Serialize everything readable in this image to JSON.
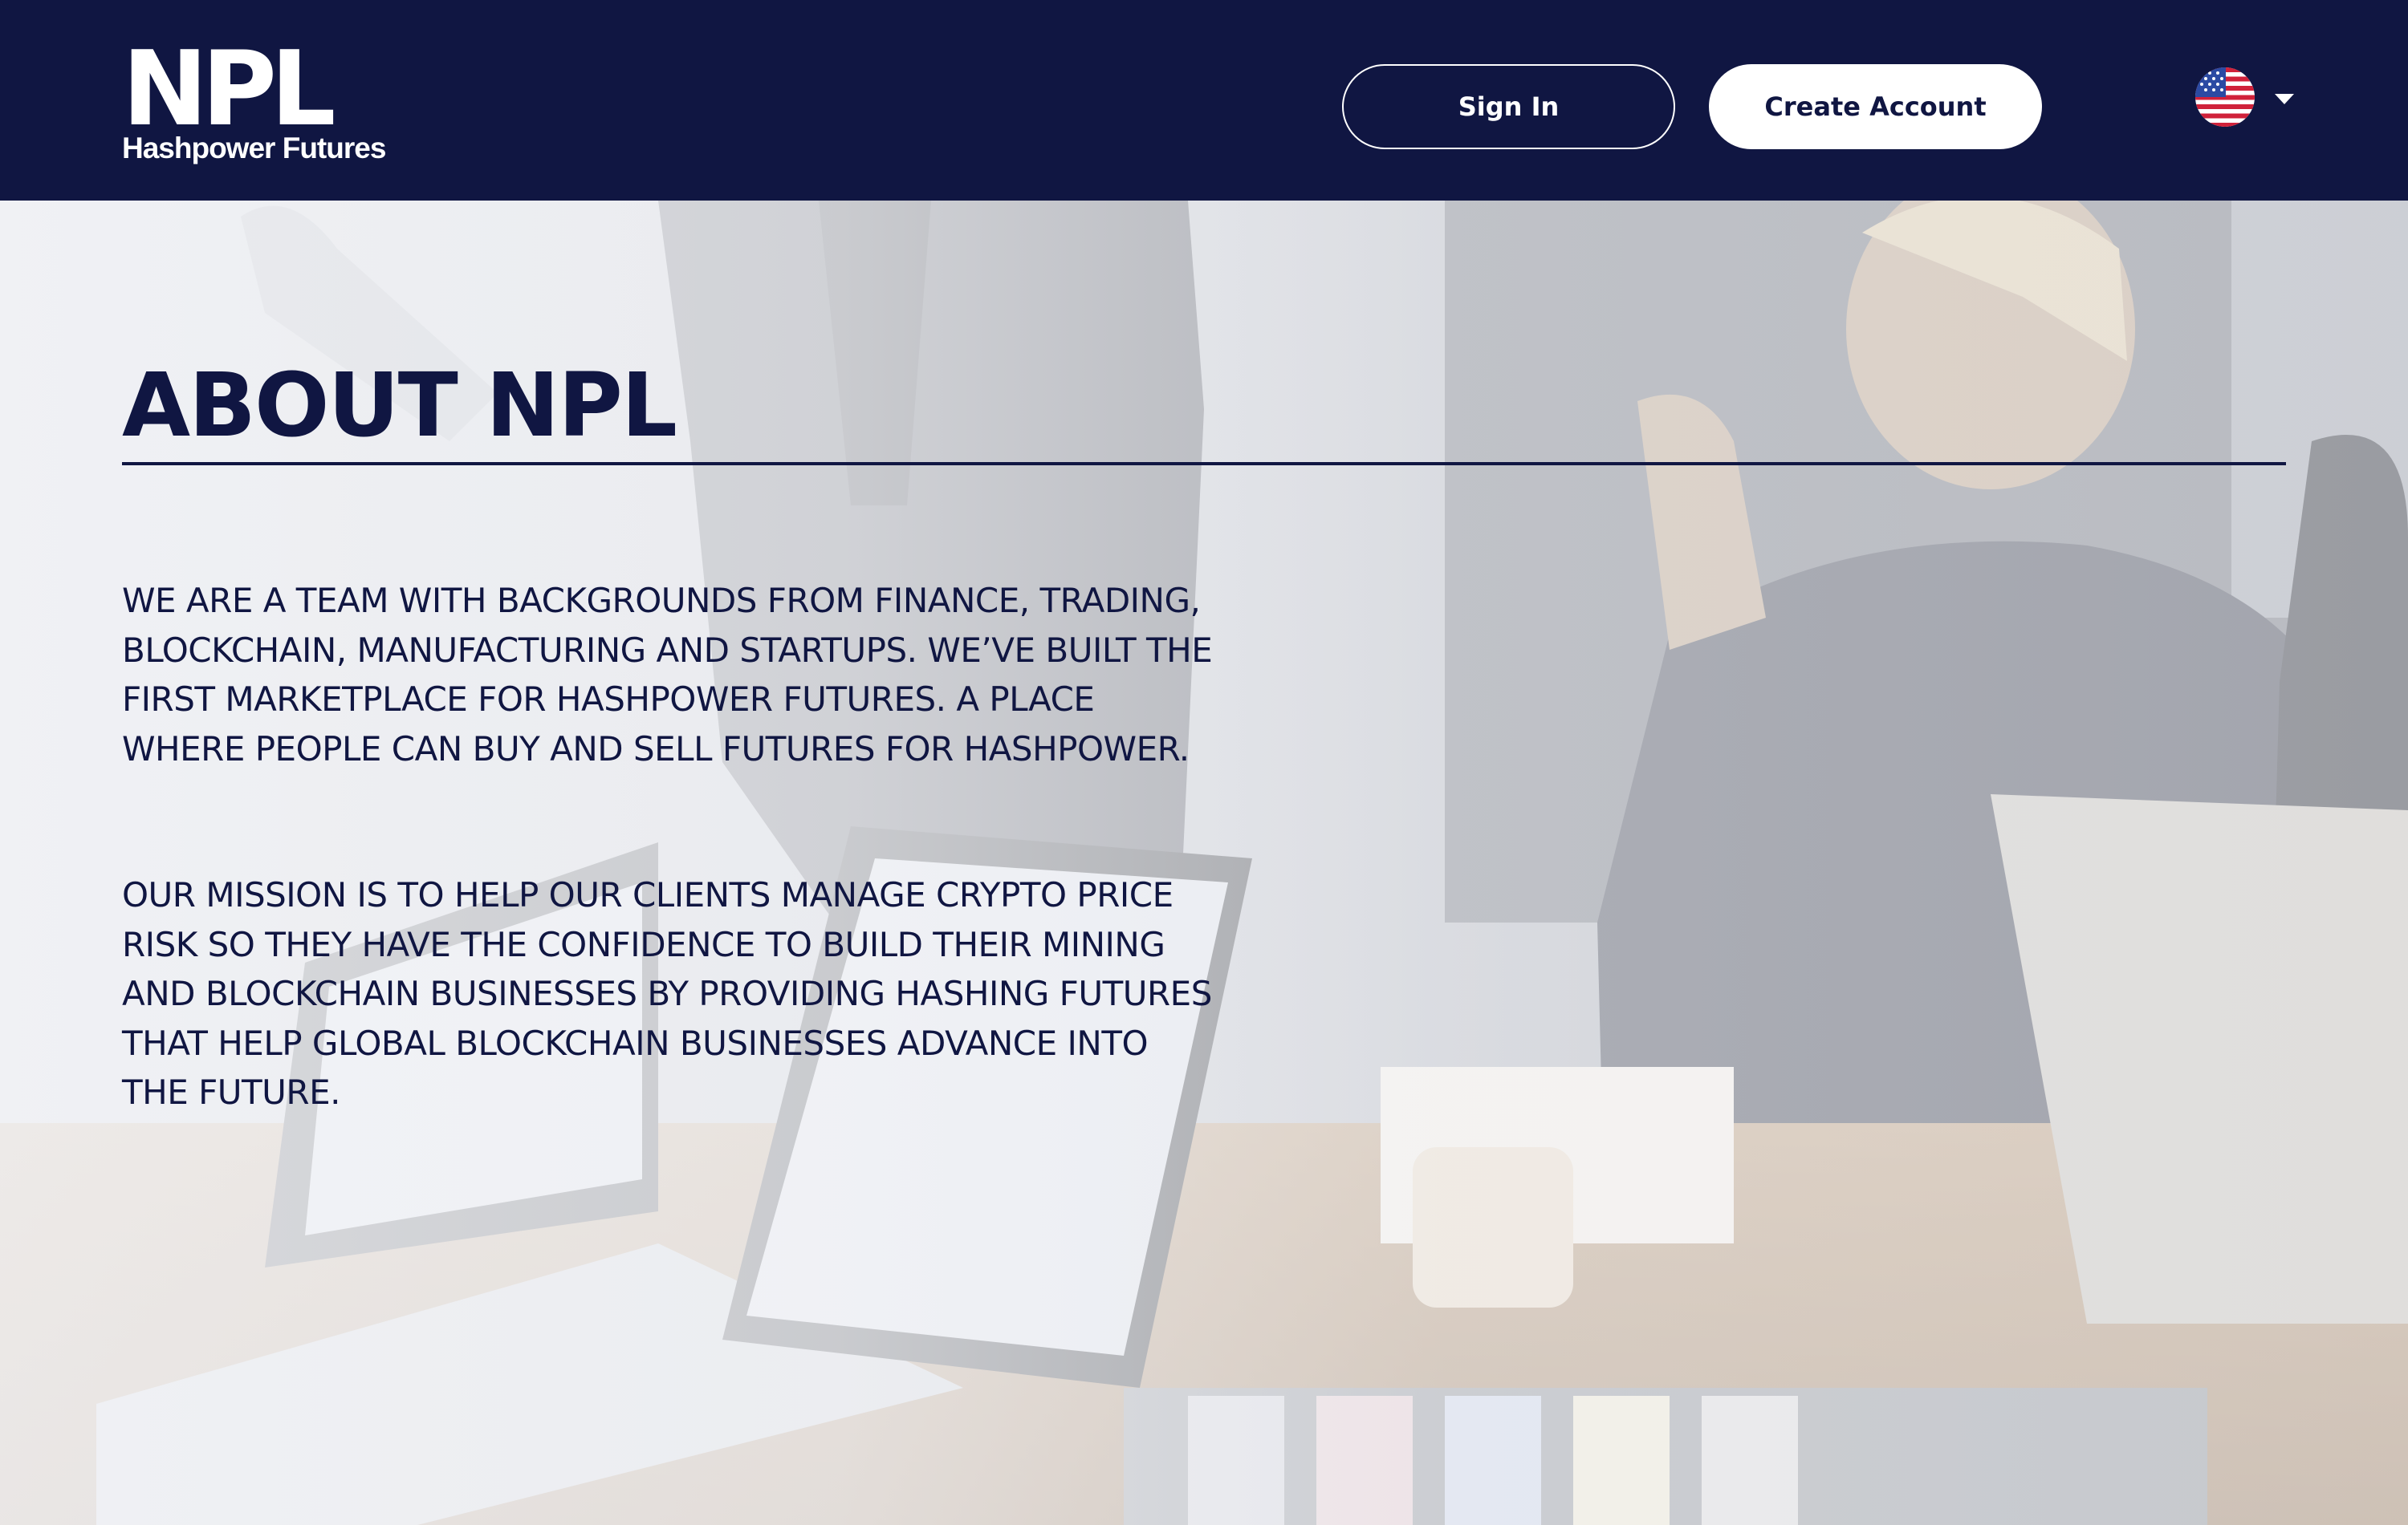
{
  "header": {
    "logo_mark": "NPL",
    "logo_subtitle": "Hashpower Futures",
    "sign_in_label": "Sign In",
    "create_account_label": "Create Account",
    "language_icon": "us-flag-icon"
  },
  "about": {
    "title": "ABOUT NPL",
    "paragraph_1": "WE ARE A TEAM WITH BACKGROUNDS FROM FINANCE, TRADING, BLOCKCHAIN, MANUFACTURING AND STARTUPS. WE’VE BUILT THE FIRST MARKETPLACE FOR HASHPOWER FUTURES. A PLACE WHERE PEOPLE CAN BUY AND SELL FUTURES FOR HASHPOWER.",
    "paragraph_2": "OUR MISSION IS TO HELP OUR CLIENTS MANAGE CRYPTO PRICE RISK SO THEY HAVE THE CONFIDENCE TO BUILD THEIR MINING AND BLOCKCHAIN BUSINESSES BY PROVIDING HASHING FUTURES THAT HELP GLOBAL BLOCKCHAIN BUSINESSES ADVANCE INTO THE FUTURE."
  },
  "colors": {
    "brand_navy": "#101642",
    "background_wash": "#f6f7fa",
    "button_white": "#ffffff"
  }
}
